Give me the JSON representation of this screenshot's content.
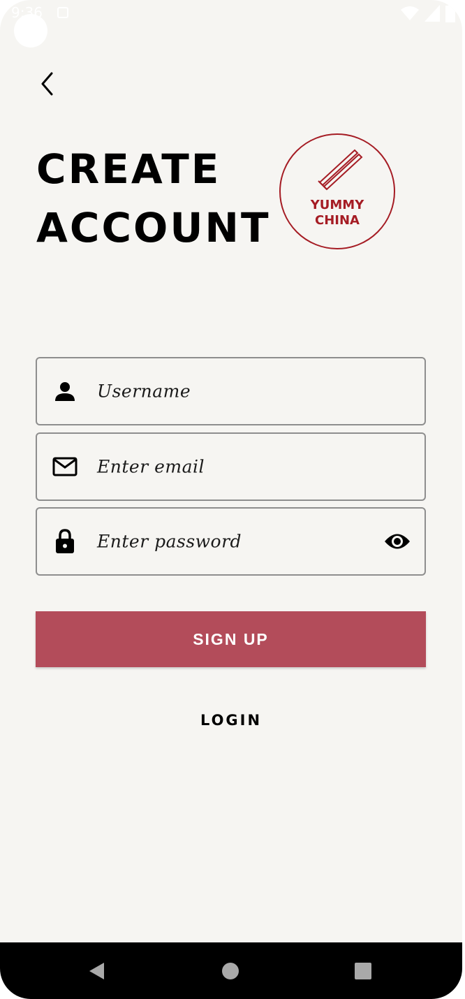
{
  "status_bar": {
    "time": "9:36",
    "colors": {
      "icons": "#ffffff"
    }
  },
  "header": {
    "back_icon": "chevron-left-icon"
  },
  "title": {
    "line1": "CREATE",
    "line2": "ACCOUNT"
  },
  "logo": {
    "line1": "YUMMY",
    "line2": "CHINA",
    "icon": "chopsticks-icon",
    "color": "#a51c24"
  },
  "form": {
    "username": {
      "placeholder": "Username",
      "icon": "person-icon"
    },
    "email": {
      "placeholder": "Enter email",
      "icon": "mail-icon"
    },
    "password": {
      "placeholder": "Enter password",
      "icon": "lock-icon",
      "toggle_icon": "eye-icon"
    }
  },
  "actions": {
    "signup_label": "SIGN UP",
    "signup_color": "#b34c5a",
    "login_label": "LOGIN"
  },
  "nav_bar": {
    "back_icon": "triangle-back-icon",
    "home_icon": "circle-home-icon",
    "recents_icon": "square-recents-icon"
  },
  "colors": {
    "background": "#f6f5f2",
    "field_border": "#8e8e8e"
  }
}
